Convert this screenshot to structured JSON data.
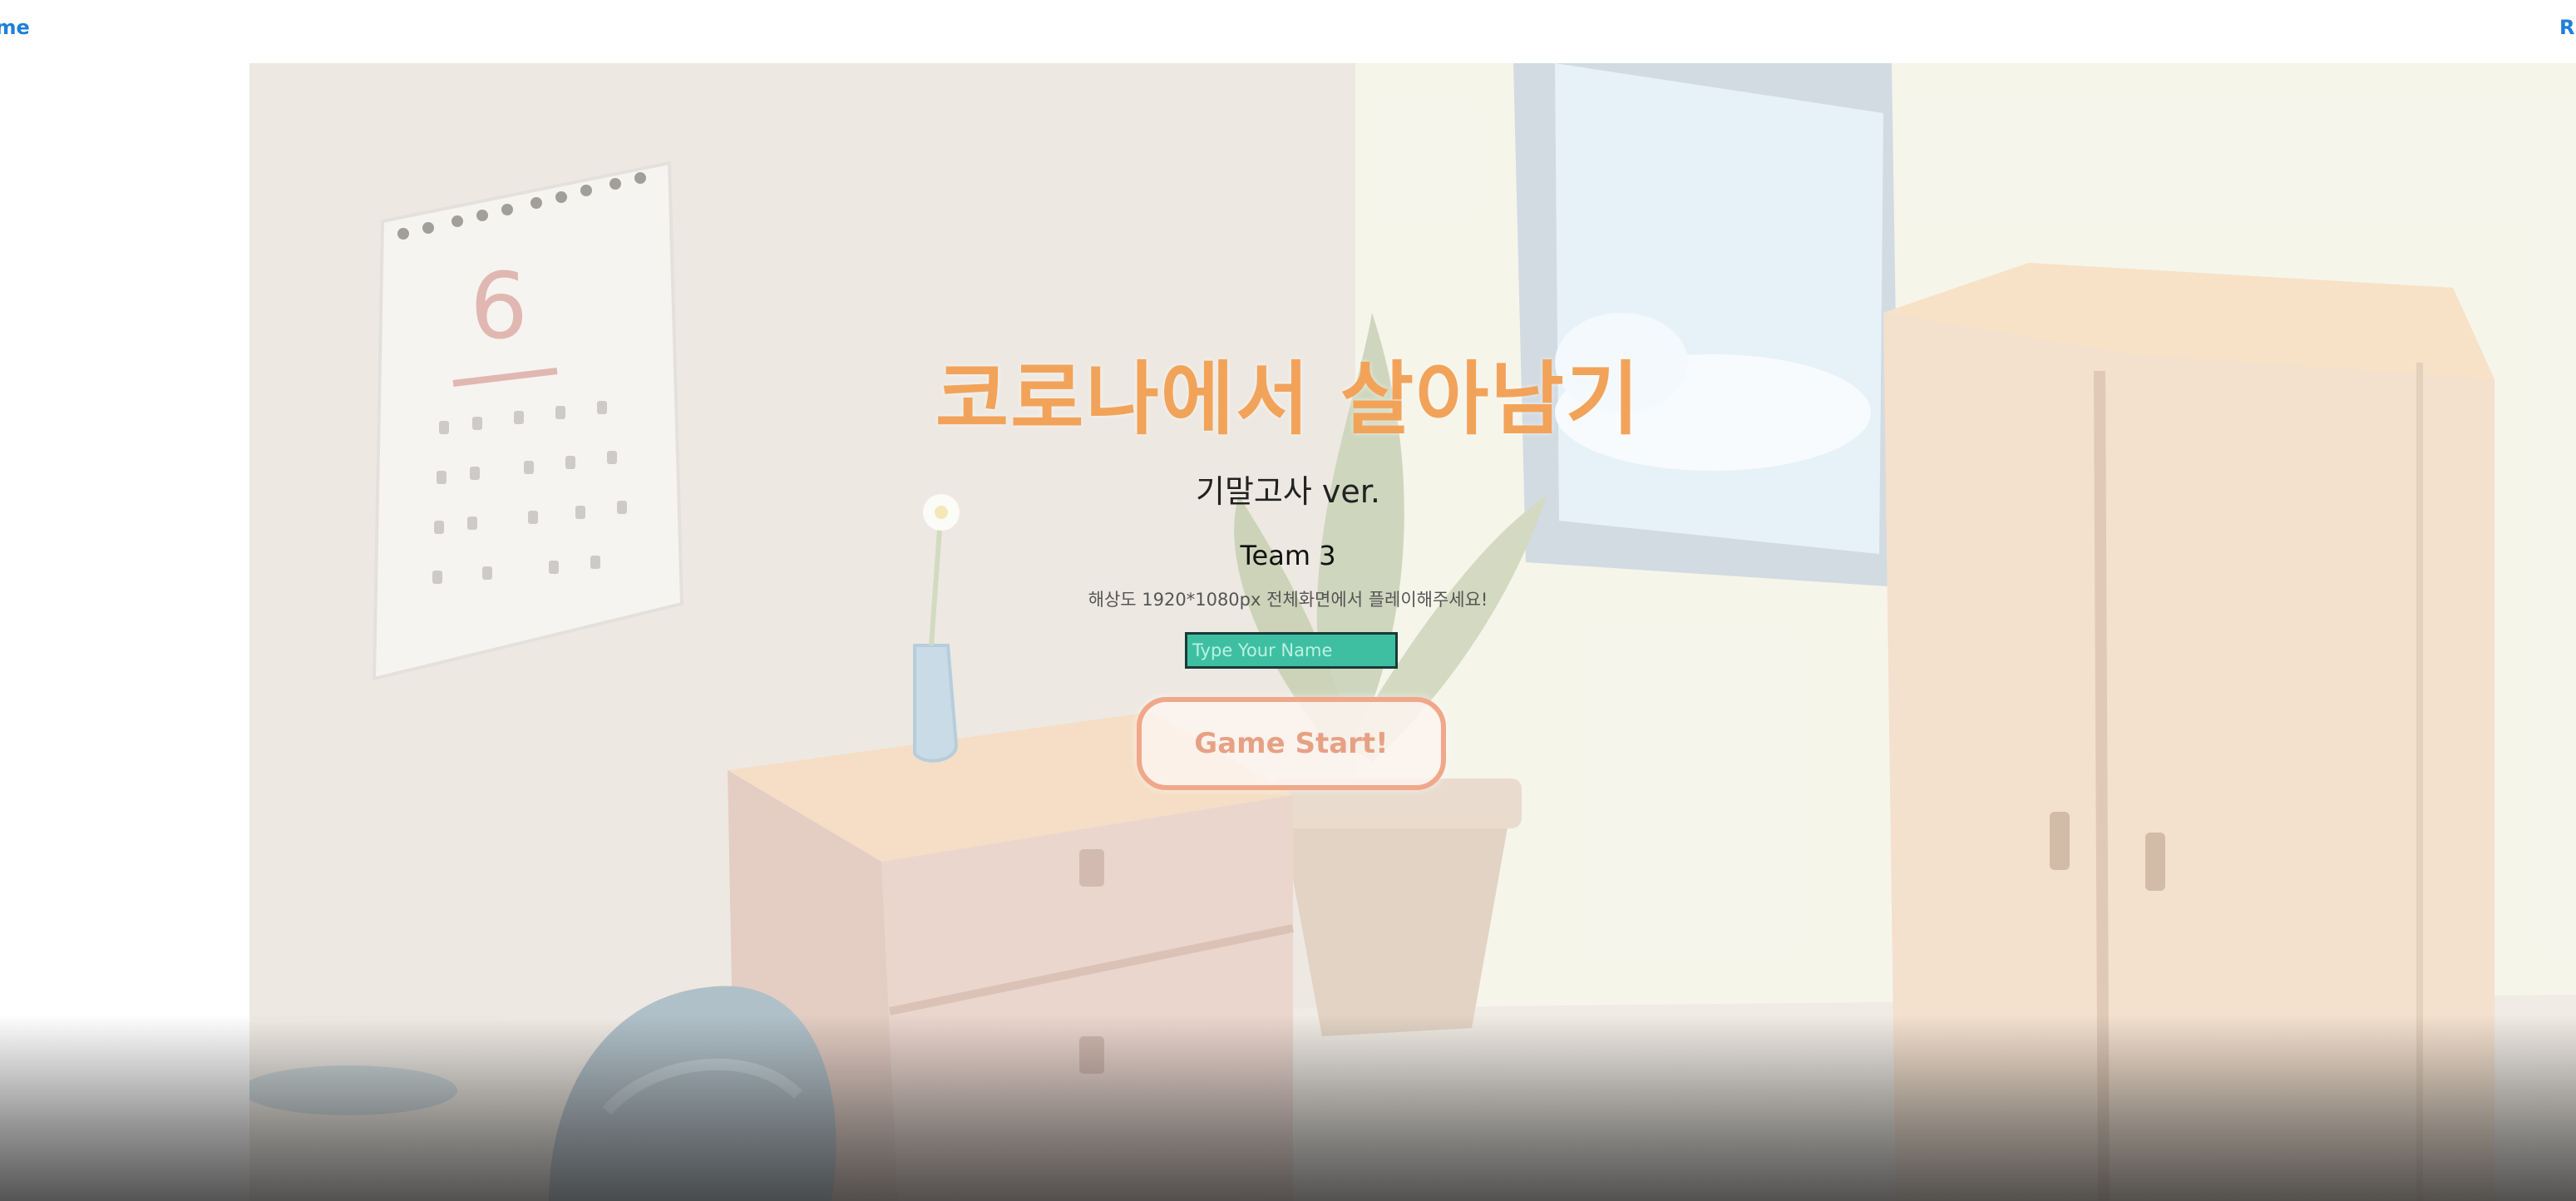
{
  "nav": {
    "home_label": "ome",
    "right_label": "R"
  },
  "game": {
    "title": "코로나에서 살아남기",
    "subtitle": "기말고사 ver.",
    "team": "Team 3",
    "notice": "해상도 1920*1080px 전체화면에서 플레이해주세요!",
    "calendar_month": "6"
  },
  "name_input": {
    "placeholder": "Type Your Name",
    "value": ""
  },
  "start_button": {
    "label": "Game Start!"
  },
  "colors": {
    "title": "#f2a35a",
    "input_bg": "#3fbfa2",
    "button_border": "#f0a78a",
    "link": "#1e7fd8"
  },
  "icons": {
    "calendar": "calendar-icon",
    "vase": "vase-icon",
    "plant": "plant-icon",
    "window": "window-icon",
    "wardrobe": "wardrobe-icon",
    "dresser": "dresser-icon",
    "backpack": "backpack-icon",
    "trash_bin": "trash-bin-icon"
  }
}
